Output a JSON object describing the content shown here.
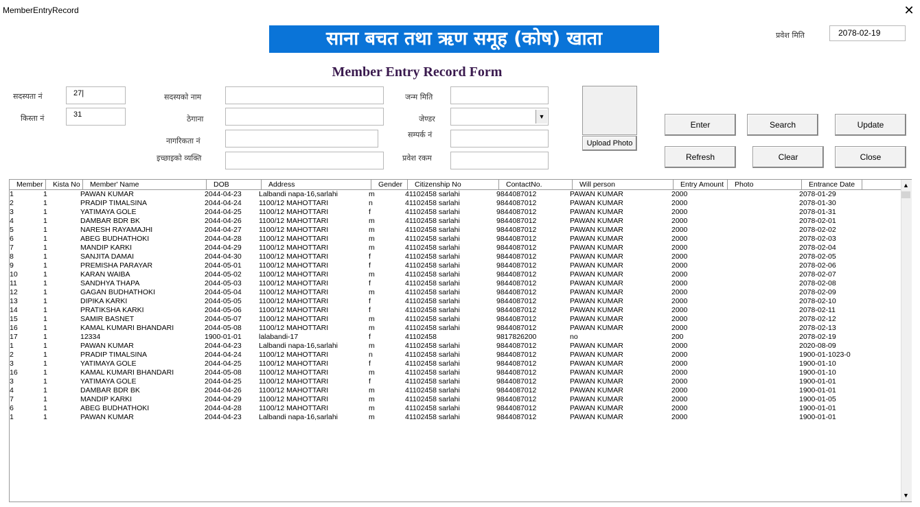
{
  "window": {
    "title": "MemberEntryRecord",
    "close_glyph": "✕"
  },
  "banner": {
    "text": "साना बचत तथा ऋण समूह (कोष) खाता"
  },
  "entry_date": {
    "label": "प्रवेश मिति",
    "value": "2078-02-19"
  },
  "form_title": "Member Entry Record Form",
  "fields": {
    "member_no": {
      "label": "सदस्यता नं",
      "value": "27|"
    },
    "kista_no": {
      "label": "किस्ता नं",
      "value": "31"
    },
    "member_name": {
      "label": "सदस्यको नाम",
      "value": ""
    },
    "address": {
      "label": "ठेगाना",
      "value": ""
    },
    "citizenship": {
      "label": "नागरिकता नं",
      "value": ""
    },
    "will_person": {
      "label": "इच्छाइको व्यक्ति",
      "value": ""
    },
    "dob": {
      "label": "जन्म मिति",
      "value": ""
    },
    "gender": {
      "label": "जेण्डर",
      "value": ""
    },
    "contact": {
      "label": "सम्पर्क नं",
      "value": ""
    },
    "entry_amount": {
      "label": "प्रवेश रकम",
      "value": ""
    }
  },
  "upload_photo_label": "Upload Photo",
  "buttons": {
    "enter": "Enter",
    "search": "Search",
    "update": "Update",
    "refresh": "Refresh",
    "clear": "Clear",
    "close": "Close"
  },
  "table": {
    "columns": [
      "Member N",
      "Kista No",
      "Member' Name",
      "DOB",
      "Address",
      "Gender",
      "Citizenship No",
      "ContactNo.",
      "Will person",
      "Entry Amount",
      "Photo",
      "Entrance Date"
    ],
    "rows": [
      [
        "1",
        "1",
        "PAWAN KUMAR",
        "2044-04-23",
        "Lalbandi napa-16,sarlahi",
        "m",
        "41102458 sarlahi",
        "9844087012",
        "PAWAN KUMAR",
        "2000",
        "",
        "2078-01-29"
      ],
      [
        "2",
        "1",
        "PRADIP TIMALSINA",
        "2044-04-24",
        "1100/12 MAHOTTARI",
        "n",
        "41102458 sarlahi",
        "9844087012",
        "PAWAN KUMAR",
        "2000",
        "",
        "2078-01-30"
      ],
      [
        "3",
        "1",
        "YATIMAYA GOLE",
        "2044-04-25",
        "1100/12 MAHOTTARI",
        "f",
        "41102458 sarlahi",
        "9844087012",
        "PAWAN KUMAR",
        "2000",
        "",
        "2078-01-31"
      ],
      [
        "4",
        "1",
        "DAMBAR BDR BK",
        "2044-04-26",
        "1100/12 MAHOTTARI",
        "m",
        "41102458 sarlahi",
        "9844087012",
        "PAWAN KUMAR",
        "2000",
        "",
        "2078-02-01"
      ],
      [
        "5",
        "1",
        "NARESH RAYAMAJHI",
        "2044-04-27",
        "1100/12 MAHOTTARI",
        "m",
        "41102458 sarlahi",
        "9844087012",
        "PAWAN KUMAR",
        "2000",
        "",
        "2078-02-02"
      ],
      [
        "6",
        "1",
        "ABEG BUDHATHOKI",
        "2044-04-28",
        "1100/12 MAHOTTARI",
        "m",
        "41102458 sarlahi",
        "9844087012",
        "PAWAN KUMAR",
        "2000",
        "",
        "2078-02-03"
      ],
      [
        "7",
        "1",
        "MANDIP KARKI",
        "2044-04-29",
        "1100/12 MAHOTTARI",
        "m",
        "41102458 sarlahi",
        "9844087012",
        "PAWAN KUMAR",
        "2000",
        "",
        "2078-02-04"
      ],
      [
        "8",
        "1",
        "SANJITA DAMAI",
        "2044-04-30",
        "1100/12 MAHOTTARI",
        "f",
        "41102458 sarlahi",
        "9844087012",
        "PAWAN KUMAR",
        "2000",
        "",
        "2078-02-05"
      ],
      [
        "9",
        "1",
        "PREMISHA  PARAYAR",
        "2044-05-01",
        "1100/12 MAHOTTARI",
        "f",
        "41102458 sarlahi",
        "9844087012",
        "PAWAN KUMAR",
        "2000",
        "",
        "2078-02-06"
      ],
      [
        "10",
        "1",
        "KARAN WAIBA",
        "2044-05-02",
        "1100/12 MAHOTTARI",
        "m",
        "41102458 sarlahi",
        "9844087012",
        "PAWAN KUMAR",
        "2000",
        "",
        "2078-02-07"
      ],
      [
        "11",
        "1",
        "SANDHYA THAPA",
        "2044-05-03",
        "1100/12 MAHOTTARI",
        "f",
        "41102458 sarlahi",
        "9844087012",
        "PAWAN KUMAR",
        "2000",
        "",
        "2078-02-08"
      ],
      [
        "12",
        "1",
        "GAGAN BUDHATHOKI",
        "2044-05-04",
        "1100/12 MAHOTTARI",
        "m",
        "41102458 sarlahi",
        "9844087012",
        "PAWAN KUMAR",
        "2000",
        "",
        "2078-02-09"
      ],
      [
        "13",
        "1",
        "DIPIKA KARKI",
        "2044-05-05",
        "1100/12 MAHOTTARI",
        "f",
        "41102458 sarlahi",
        "9844087012",
        "PAWAN KUMAR",
        "2000",
        "",
        "2078-02-10"
      ],
      [
        "14",
        "1",
        "PRATIKSHA KARKI",
        "2044-05-06",
        "1100/12 MAHOTTARI",
        "f",
        "41102458 sarlahi",
        "9844087012",
        "PAWAN KUMAR",
        "2000",
        "",
        "2078-02-11"
      ],
      [
        "15",
        "1",
        "SAMIR BASNET",
        "2044-05-07",
        "1100/12 MAHOTTARI",
        "m",
        "41102458 sarlahi",
        "9844087012",
        "PAWAN KUMAR",
        "2000",
        "",
        "2078-02-12"
      ],
      [
        "16",
        "1",
        "KAMAL KUMARI BHANDARI",
        "2044-05-08",
        "1100/12 MAHOTTARI",
        "m",
        "41102458 sarlahi",
        "9844087012",
        "PAWAN KUMAR",
        "2000",
        "",
        "2078-02-13"
      ],
      [
        "17",
        "1",
        "12334",
        "1900-01-01",
        "lalabandi-17",
        "f",
        "41102458",
        "9817826200",
        "no",
        "200",
        "",
        "2078-02-19"
      ],
      [
        "1",
        "1",
        "PAWAN KUMAR",
        "2044-04-23",
        "Lalbandi napa-16,sarlahi",
        "m",
        "41102458 sarlahi",
        "9844087012",
        "PAWAN KUMAR",
        "2000",
        "",
        "2020-08-09"
      ],
      [
        "2",
        "1",
        "PRADIP TIMALSINA",
        "2044-04-24",
        "1100/12 MAHOTTARI",
        "n",
        "41102458 sarlahi",
        "9844087012",
        "PAWAN KUMAR",
        "2000",
        "",
        "1900-01-1023-0"
      ],
      [
        "3",
        "1",
        "YATIMAYA GOLE",
        "2044-04-25",
        "1100/12 MAHOTTARI",
        "f",
        "41102458 sarlahi",
        "9844087012",
        "PAWAN KUMAR",
        "2000",
        "",
        "1900-01-10"
      ],
      [
        "16",
        "1",
        "KAMAL KUMARI BHANDARI",
        "2044-05-08",
        "1100/12 MAHOTTARI",
        "m",
        "41102458 sarlahi",
        "9844087012",
        "PAWAN KUMAR",
        "2000",
        "",
        "1900-01-10"
      ],
      [
        "3",
        "1",
        "YATIMAYA GOLE",
        "2044-04-25",
        "1100/12 MAHOTTARI",
        "f",
        "41102458 sarlahi",
        "9844087012",
        "PAWAN KUMAR",
        "2000",
        "",
        "1900-01-01"
      ],
      [
        "4",
        "1",
        "DAMBAR BDR BK",
        "2044-04-26",
        "1100/12 MAHOTTARI",
        "m",
        "41102458 sarlahi",
        "9844087012",
        "PAWAN KUMAR",
        "2000",
        "",
        "1900-01-01"
      ],
      [
        "7",
        "1",
        "MANDIP KARKI",
        "2044-04-29",
        "1100/12 MAHOTTARI",
        "m",
        "41102458 sarlahi",
        "9844087012",
        "PAWAN KUMAR",
        "2000",
        "",
        "1900-01-05"
      ],
      [
        "6",
        "1",
        "ABEG BUDHATHOKI",
        "2044-04-28",
        "1100/12 MAHOTTARI",
        "m",
        "41102458 sarlahi",
        "9844087012",
        "PAWAN KUMAR",
        "2000",
        "",
        "1900-01-01"
      ],
      [
        "1",
        "1",
        "PAWAN KUMAR",
        "2044-04-23",
        "Lalbandi napa-16,sarlahi",
        "m",
        "41102458 sarlahi",
        "9844087012",
        "PAWAN KUMAR",
        "2000",
        "",
        "1900-01-01"
      ]
    ]
  },
  "colors": {
    "banner_bg": "#0a74d8",
    "title_color": "#3a1a4e"
  }
}
